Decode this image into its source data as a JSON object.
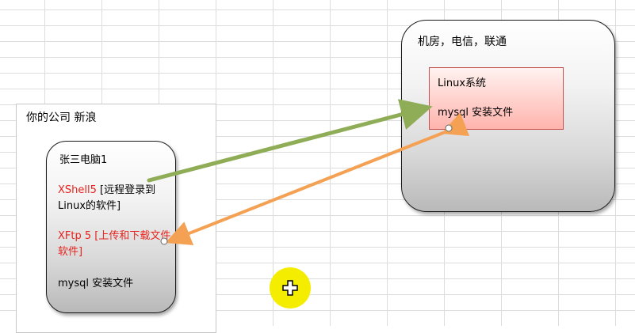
{
  "company": {
    "title": "你的公司 新浪"
  },
  "pc": {
    "title": "张三电脑1",
    "xshell_label": "XShell5 [远程登录到Linux的软件]",
    "xftp_label": "XFtp 5 [上传和下载文件软件]",
    "mysql_label": "mysql 安装文件"
  },
  "server": {
    "title": "机房，电信，联通",
    "linux_title": "Linux系统",
    "mysql_label": "mysql 安装文件"
  },
  "colors": {
    "green_arrow": "#8fac56",
    "orange_arrow": "#f4a153",
    "red_text": "#e8231d",
    "cursor_highlight": "#f5ed00"
  },
  "icons": {
    "cursor": "crosshair-cursor-icon"
  }
}
